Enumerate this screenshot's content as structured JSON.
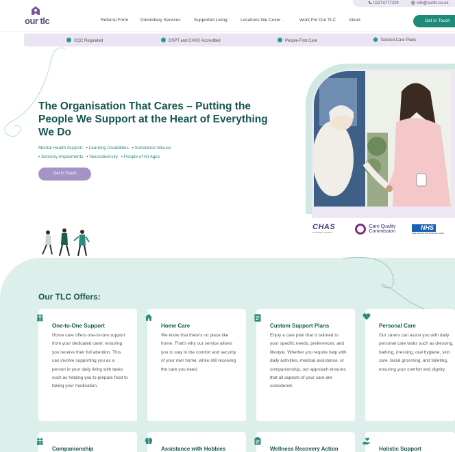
{
  "topbar": {
    "phone": "01274777229",
    "email": "info@ourtlc.co.uk"
  },
  "brand": {
    "name": "our tlc"
  },
  "nav": {
    "items": [
      "Referral Form",
      "Domiciliary Services",
      "Supported Living",
      "Locations We Cover",
      "Work For Our TLC",
      "About"
    ],
    "cta": "Get In Touch"
  },
  "features": [
    "CQC Regulated",
    "DSPT and CHAS Accredited",
    "People-First Care",
    "Tailored Care Plans"
  ],
  "hero": {
    "title": "The Organisation That Cares – Putting the People We Support at the Heart of Everything We Do",
    "tags": [
      "Mental Health Support",
      "Learning Disabilities",
      "Substance Misuse",
      "Sensory Impairments",
      "Neurodiversity",
      "People of All Ages"
    ],
    "cta": "Get In Touch"
  },
  "accreditations": {
    "chas": "CHAS",
    "chas_sub": "Accredited Contractor",
    "cqc_line1": "Care Quality",
    "cqc_line2": "Commission",
    "nhs": "NHS",
    "nhs_sub": "Data Security and Protection toolkit"
  },
  "offers": {
    "title": "Our TLC Offers:",
    "cards": [
      {
        "title": "One-to-One Support",
        "icon": "people-icon",
        "text": "Home care offers one-to-one support from your dedicated carer, ensuring you receive their full attention. This can involve supporting you as a person in your daily living with tasks such as helping you to prepare food to taking your medication."
      },
      {
        "title": "Home Care",
        "icon": "home-icon",
        "text": "We know that there's no place like home. That's why our service allows you to stay in the comfort and security of your own home, while still receiving the care you need."
      },
      {
        "title": "Custom Support Plans",
        "icon": "notebook-icon",
        "text": "Enjoy a care plan that is tailored to your specific needs, preferences, and lifestyle. Whether you require help with daily activities, medical assistance, or companionship, our approach ensures that all aspects of your care are considered."
      },
      {
        "title": "Personal Care",
        "icon": "heart-icon",
        "text": "Our carers can assist you with daily personal care tasks such as dressing, bathing, dressing, oral hygiene, skin care, facial grooming, and toileting, ensuring your comfort and dignity."
      },
      {
        "title": "Companionship",
        "icon": "people-icon",
        "text": ""
      },
      {
        "title": "Assistance with Hobbies",
        "icon": "brain-icon",
        "text": ""
      },
      {
        "title": "Wellness Recovery Action",
        "icon": "clipboard-icon",
        "text": ""
      },
      {
        "title": "Holistic Support",
        "icon": "hand-heart-icon",
        "text": ""
      }
    ]
  },
  "colors": {
    "teal_dark": "#16564f",
    "teal": "#1e8a78",
    "lavender": "#a693c6",
    "lavender_light": "#ebe5f3",
    "mint_bg": "#dcefeb"
  }
}
